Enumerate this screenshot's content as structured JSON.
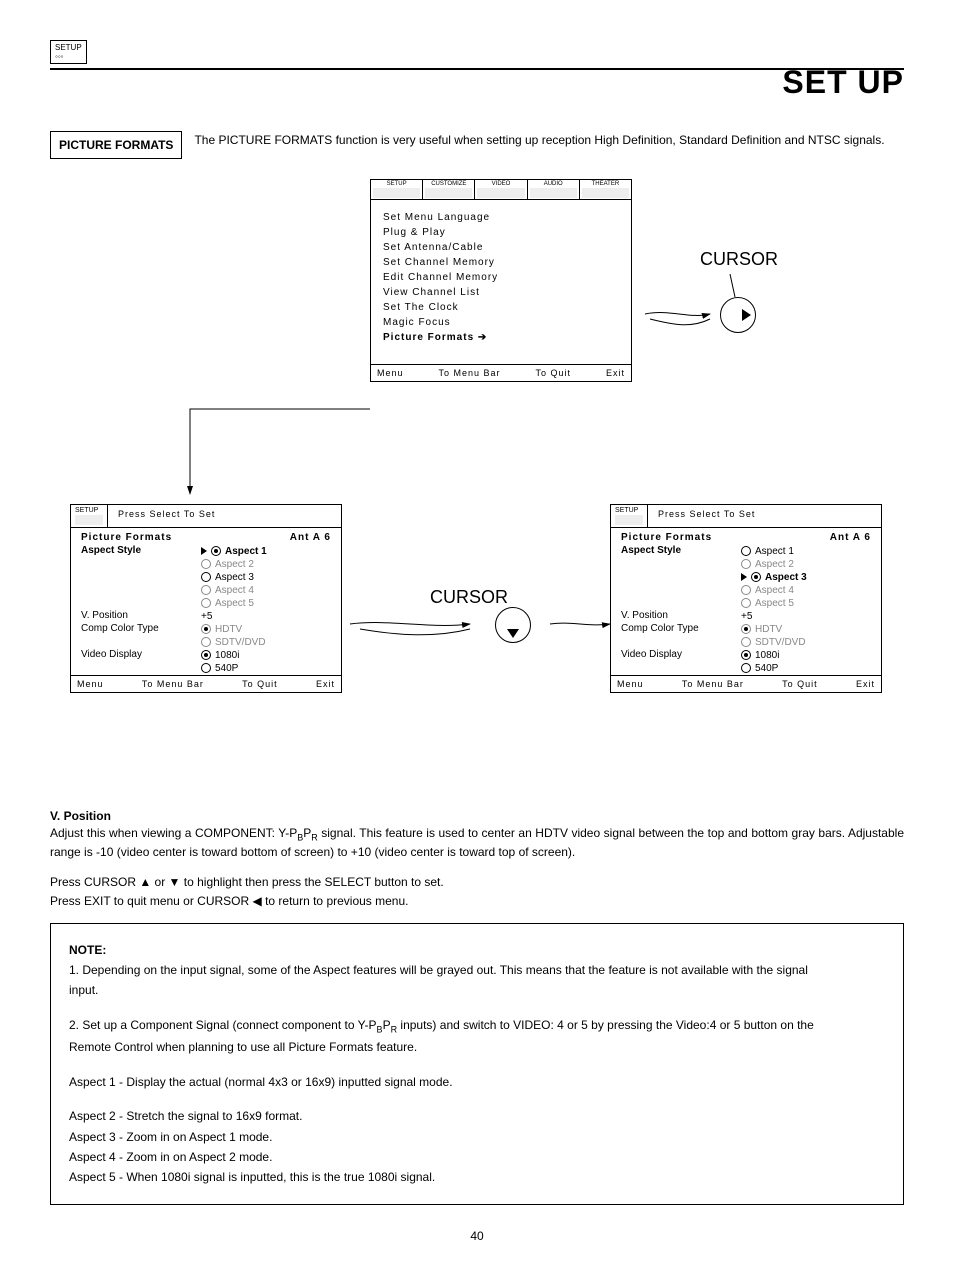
{
  "header": {
    "setup_icon": "SETUP",
    "title": "SET UP"
  },
  "intro": {
    "box": "PICTURE FORMATS",
    "text": "The PICTURE FORMATS function is very useful when setting up reception High Definition, Standard Definition and NTSC signals."
  },
  "labels": {
    "cursor": "CURSOR",
    "select": "SELECT"
  },
  "osd_main": {
    "tabs": [
      "SETUP",
      "CUSTOMIZE",
      "VIDEO",
      "AUDIO",
      "THEATER"
    ],
    "items": [
      "Set Menu Language",
      "Plug & Play",
      "Set Antenna/Cable",
      "Set Channel Memory",
      "Edit Channel Memory",
      "View Channel List",
      "Set The Clock",
      "Magic Focus"
    ],
    "active": "Picture Formats",
    "foot": {
      "menu": "Menu",
      "bar": "To Menu Bar",
      "quit": "To Quit",
      "exit": "Exit"
    }
  },
  "osd_pf": {
    "hint": "Press Select To Set",
    "title": "Picture Formats",
    "source": "Ant A 6",
    "rows": {
      "aspect_style": "Aspect Style",
      "vpos": "V. Position",
      "vpos_val": "+5",
      "comp": "Comp Color Type",
      "vid": "Video Display"
    },
    "aspects": [
      "Aspect 1",
      "Aspect 2",
      "Aspect 3",
      "Aspect 4",
      "Aspect 5"
    ],
    "comp_opts": [
      "HDTV",
      "SDTV/DVD"
    ],
    "vid_opts": [
      "1080i",
      "540P"
    ]
  },
  "left_panel": {
    "aspect_selected": 0,
    "aspect_gray": [
      1,
      3,
      4
    ]
  },
  "right_panel": {
    "aspect_selected": 2,
    "aspect_gray": [
      1,
      3,
      4
    ]
  },
  "vposition": {
    "head": "V. Position",
    "p1a": "Adjust this when viewing a COMPONENT: Y-P",
    "p1b": "P",
    "p1c": " signal.  This feature is used to center an HDTV video signal between the top and bottom gray bars.  Adjustable range is -10 (video center is toward bottom of screen) to +10 (video center is toward top of screen).",
    "p2": "Press CURSOR ▲ or ▼ to highlight then press the SELECT button to set.",
    "p3": "Press EXIT to quit menu or CURSOR ◀ to return to previous menu."
  },
  "note": {
    "head": "NOTE:",
    "n1": "1.  Depending on the input signal, some of the Aspect features will be grayed out.  This means that the feature is not available with the signal input.",
    "n2a": "2.  Set up a Component Signal (connect component to Y-P",
    "n2b": "P",
    "n2c": " inputs) and switch to VIDEO: 4 or 5 by pressing the Video:4 or 5 button on the Remote Control when planning to use all Picture Formats feature.",
    "a1": "Aspect 1 - Display the actual (normal 4x3 or 16x9) inputted signal mode.",
    "a2": "Aspect 2 - Stretch the signal to 16x9 format.",
    "a3": "Aspect 3 - Zoom in on Aspect 1 mode.",
    "a4": "Aspect 4 - Zoom in on Aspect 2 mode.",
    "a5": "Aspect 5 - When 1080i signal is inputted, this is the true 1080i signal."
  },
  "pagenum": "40"
}
